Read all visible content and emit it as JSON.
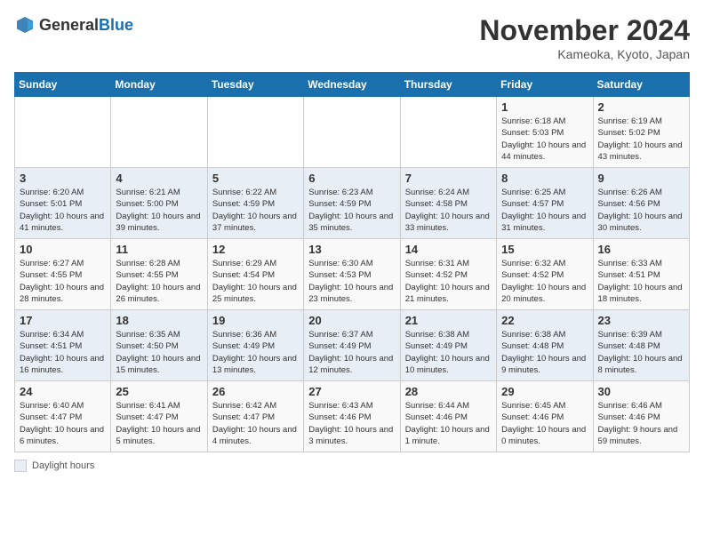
{
  "header": {
    "logo_general": "General",
    "logo_blue": "Blue",
    "month_title": "November 2024",
    "location": "Kameoka, Kyoto, Japan"
  },
  "days_of_week": [
    "Sunday",
    "Monday",
    "Tuesday",
    "Wednesday",
    "Thursday",
    "Friday",
    "Saturday"
  ],
  "legend_label": "Daylight hours",
  "weeks": [
    [
      {
        "day": "",
        "info": ""
      },
      {
        "day": "",
        "info": ""
      },
      {
        "day": "",
        "info": ""
      },
      {
        "day": "",
        "info": ""
      },
      {
        "day": "",
        "info": ""
      },
      {
        "day": "1",
        "info": "Sunrise: 6:18 AM\nSunset: 5:03 PM\nDaylight: 10 hours and 44 minutes."
      },
      {
        "day": "2",
        "info": "Sunrise: 6:19 AM\nSunset: 5:02 PM\nDaylight: 10 hours and 43 minutes."
      }
    ],
    [
      {
        "day": "3",
        "info": "Sunrise: 6:20 AM\nSunset: 5:01 PM\nDaylight: 10 hours and 41 minutes."
      },
      {
        "day": "4",
        "info": "Sunrise: 6:21 AM\nSunset: 5:00 PM\nDaylight: 10 hours and 39 minutes."
      },
      {
        "day": "5",
        "info": "Sunrise: 6:22 AM\nSunset: 4:59 PM\nDaylight: 10 hours and 37 minutes."
      },
      {
        "day": "6",
        "info": "Sunrise: 6:23 AM\nSunset: 4:59 PM\nDaylight: 10 hours and 35 minutes."
      },
      {
        "day": "7",
        "info": "Sunrise: 6:24 AM\nSunset: 4:58 PM\nDaylight: 10 hours and 33 minutes."
      },
      {
        "day": "8",
        "info": "Sunrise: 6:25 AM\nSunset: 4:57 PM\nDaylight: 10 hours and 31 minutes."
      },
      {
        "day": "9",
        "info": "Sunrise: 6:26 AM\nSunset: 4:56 PM\nDaylight: 10 hours and 30 minutes."
      }
    ],
    [
      {
        "day": "10",
        "info": "Sunrise: 6:27 AM\nSunset: 4:55 PM\nDaylight: 10 hours and 28 minutes."
      },
      {
        "day": "11",
        "info": "Sunrise: 6:28 AM\nSunset: 4:55 PM\nDaylight: 10 hours and 26 minutes."
      },
      {
        "day": "12",
        "info": "Sunrise: 6:29 AM\nSunset: 4:54 PM\nDaylight: 10 hours and 25 minutes."
      },
      {
        "day": "13",
        "info": "Sunrise: 6:30 AM\nSunset: 4:53 PM\nDaylight: 10 hours and 23 minutes."
      },
      {
        "day": "14",
        "info": "Sunrise: 6:31 AM\nSunset: 4:52 PM\nDaylight: 10 hours and 21 minutes."
      },
      {
        "day": "15",
        "info": "Sunrise: 6:32 AM\nSunset: 4:52 PM\nDaylight: 10 hours and 20 minutes."
      },
      {
        "day": "16",
        "info": "Sunrise: 6:33 AM\nSunset: 4:51 PM\nDaylight: 10 hours and 18 minutes."
      }
    ],
    [
      {
        "day": "17",
        "info": "Sunrise: 6:34 AM\nSunset: 4:51 PM\nDaylight: 10 hours and 16 minutes."
      },
      {
        "day": "18",
        "info": "Sunrise: 6:35 AM\nSunset: 4:50 PM\nDaylight: 10 hours and 15 minutes."
      },
      {
        "day": "19",
        "info": "Sunrise: 6:36 AM\nSunset: 4:49 PM\nDaylight: 10 hours and 13 minutes."
      },
      {
        "day": "20",
        "info": "Sunrise: 6:37 AM\nSunset: 4:49 PM\nDaylight: 10 hours and 12 minutes."
      },
      {
        "day": "21",
        "info": "Sunrise: 6:38 AM\nSunset: 4:49 PM\nDaylight: 10 hours and 10 minutes."
      },
      {
        "day": "22",
        "info": "Sunrise: 6:38 AM\nSunset: 4:48 PM\nDaylight: 10 hours and 9 minutes."
      },
      {
        "day": "23",
        "info": "Sunrise: 6:39 AM\nSunset: 4:48 PM\nDaylight: 10 hours and 8 minutes."
      }
    ],
    [
      {
        "day": "24",
        "info": "Sunrise: 6:40 AM\nSunset: 4:47 PM\nDaylight: 10 hours and 6 minutes."
      },
      {
        "day": "25",
        "info": "Sunrise: 6:41 AM\nSunset: 4:47 PM\nDaylight: 10 hours and 5 minutes."
      },
      {
        "day": "26",
        "info": "Sunrise: 6:42 AM\nSunset: 4:47 PM\nDaylight: 10 hours and 4 minutes."
      },
      {
        "day": "27",
        "info": "Sunrise: 6:43 AM\nSunset: 4:46 PM\nDaylight: 10 hours and 3 minutes."
      },
      {
        "day": "28",
        "info": "Sunrise: 6:44 AM\nSunset: 4:46 PM\nDaylight: 10 hours and 1 minute."
      },
      {
        "day": "29",
        "info": "Sunrise: 6:45 AM\nSunset: 4:46 PM\nDaylight: 10 hours and 0 minutes."
      },
      {
        "day": "30",
        "info": "Sunrise: 6:46 AM\nSunset: 4:46 PM\nDaylight: 9 hours and 59 minutes."
      }
    ]
  ]
}
